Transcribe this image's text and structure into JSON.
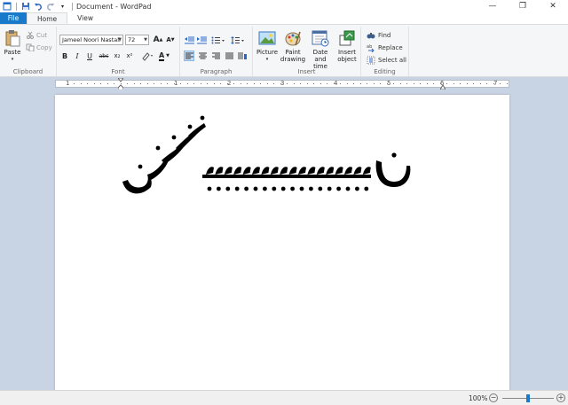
{
  "window": {
    "title": "Document - WordPad",
    "controls": {
      "minimize": "—",
      "maximize": "❐",
      "close": "✕"
    }
  },
  "tabs": [
    {
      "label": "File"
    },
    {
      "label": "Home"
    },
    {
      "label": "View"
    }
  ],
  "clipboard": {
    "paste_label": "Paste",
    "cut_label": "Cut",
    "copy_label": "Copy",
    "group_label": "Clipboard"
  },
  "font": {
    "family_value": "Jameel Noori Nastali",
    "size_value": "72",
    "group_label": "Font",
    "bold": "B",
    "italic": "I",
    "underline": "U",
    "strike": "abc",
    "subscript": "x₂",
    "superscript": "x²",
    "grow": "A",
    "shrink": "A",
    "color_a": "A"
  },
  "paragraph": {
    "group_label": "Paragraph"
  },
  "insert": {
    "picture_label": "Picture",
    "paint_label_1": "Paint",
    "paint_label_2": "drawing",
    "datetime_label_1": "Date and",
    "datetime_label_2": "time",
    "object_label_1": "Insert",
    "object_label_2": "object",
    "group_label": "Insert"
  },
  "editing": {
    "find_label": "Find",
    "replace_label": "Replace",
    "select_all_label": "Select all",
    "group_label": "Editing"
  },
  "ruler": {
    "marks": [
      "1",
      "1",
      "2",
      "3",
      "4",
      "5",
      "6",
      "7"
    ]
  },
  "document": {
    "content": "ن ـــــــــــــــ نننن"
  },
  "statusbar": {
    "zoom": "100%",
    "zoom_out": "−",
    "zoom_in": "+",
    "zoom_level": 0.5
  },
  "colors": {
    "file_tab": "#1979ca",
    "ribbon_bg": "#f5f6f7",
    "workspace": "#c8d3e3",
    "accent": "#1979ca"
  }
}
